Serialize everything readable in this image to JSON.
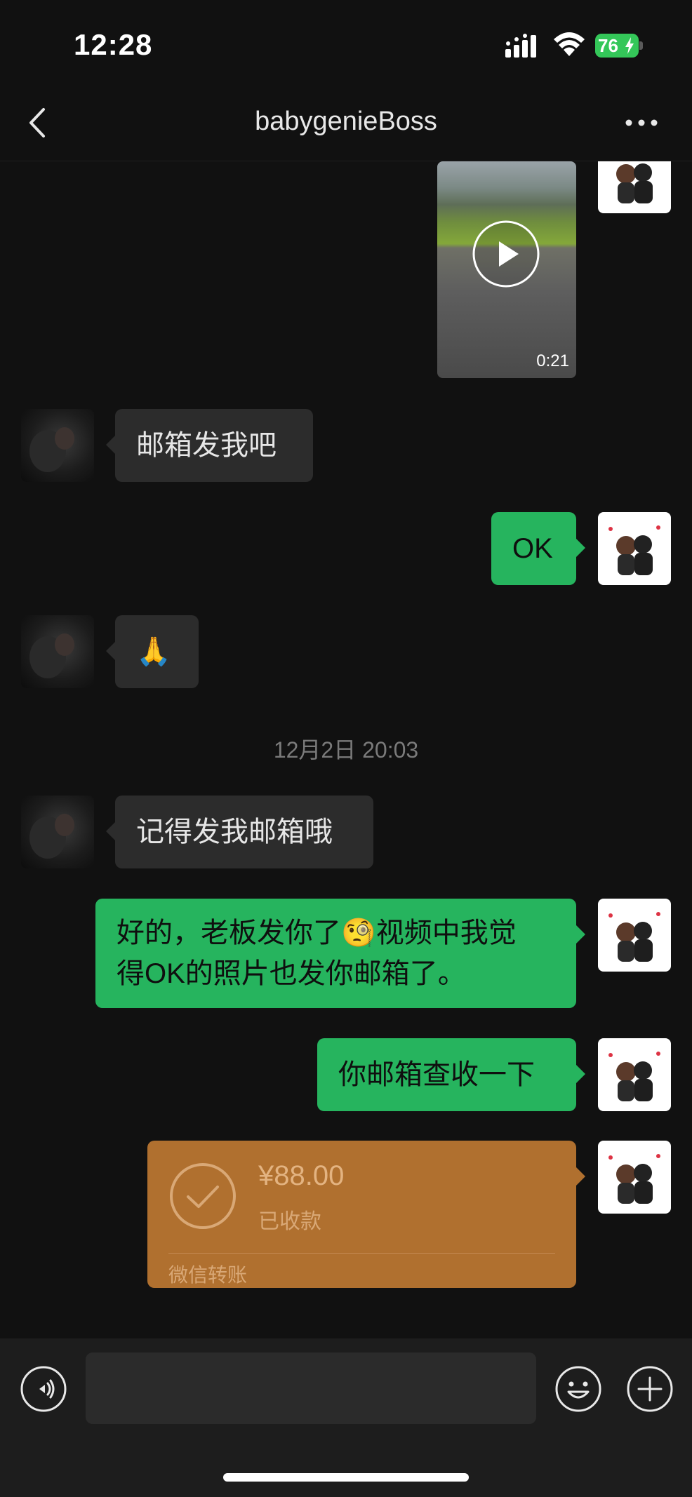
{
  "status_bar": {
    "time": "12:28",
    "battery": "76"
  },
  "nav": {
    "title": "babygenieBoss"
  },
  "messages": {
    "video": {
      "duration": "0:21"
    },
    "m1": {
      "text": "邮箱发我吧"
    },
    "m2": {
      "text": "OK"
    },
    "m3": {
      "text": "🙏"
    },
    "timestamp": "12月2日 20:03",
    "m4": {
      "text": "记得发我邮箱哦"
    },
    "m5": {
      "line1": "好的，老板发你了🧐视频中我觉",
      "line2": "得OK的照片也发你邮箱了。"
    },
    "m6": {
      "text": "你邮箱查收一下"
    },
    "transfer": {
      "amount": "¥88.00",
      "status": "已收款",
      "label": "微信转账"
    }
  },
  "colors": {
    "background": "#111111",
    "bubble_out": "#26b45e",
    "bubble_in": "#2c2c2c",
    "transfer": "#b0702f"
  },
  "icons": [
    "back-chevron-icon",
    "more-dots-icon",
    "play-icon",
    "check-circle-icon",
    "voice-icon",
    "emoji-icon",
    "plus-icon"
  ]
}
